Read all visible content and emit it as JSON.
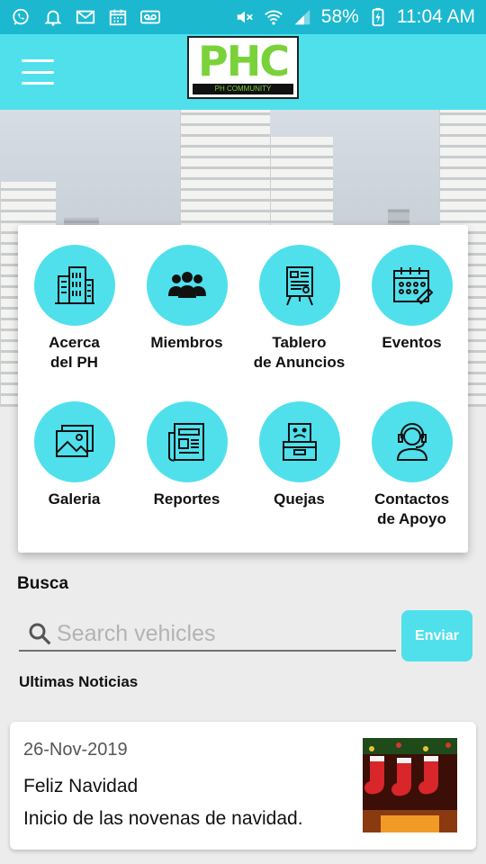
{
  "status_bar": {
    "battery": "58%",
    "time": "11:04 AM",
    "icons": [
      "whatsapp-icon",
      "notification-bell-icon",
      "gmail-icon",
      "calendar-icon",
      "voicemail-icon",
      "mute-icon",
      "wifi-icon",
      "signal-icon",
      "battery-charging-icon"
    ]
  },
  "header": {
    "logo_text": "PHC",
    "logo_subtitle": "PH COMMUNITY"
  },
  "menu": {
    "items": [
      {
        "label": "Acerca\ndel PH",
        "icon": "building-icon"
      },
      {
        "label": "Miembros",
        "icon": "group-icon"
      },
      {
        "label": "Tablero\nde Anuncios",
        "icon": "notice-board-icon"
      },
      {
        "label": "Eventos",
        "icon": "calendar-icon"
      },
      {
        "label": "Galeria",
        "icon": "gallery-icon"
      },
      {
        "label": "Reportes",
        "icon": "newspaper-icon"
      },
      {
        "label": "Quejas",
        "icon": "complaint-box-icon"
      },
      {
        "label": "Contactos\nde Apoyo",
        "icon": "support-agent-icon"
      }
    ]
  },
  "search": {
    "heading": "Busca",
    "placeholder": "Search vehicles",
    "value": "",
    "button_label": "Enviar"
  },
  "news": {
    "heading": "Ultimas Noticias",
    "items": [
      {
        "date": "26-Nov-2019",
        "title": "Feliz Navidad",
        "description": "Inicio de las novenas de navidad."
      }
    ]
  },
  "colors": {
    "accent": "#4fe0ec",
    "status_bar": "#1bb8cf",
    "logo_green": "#7ad23a"
  }
}
